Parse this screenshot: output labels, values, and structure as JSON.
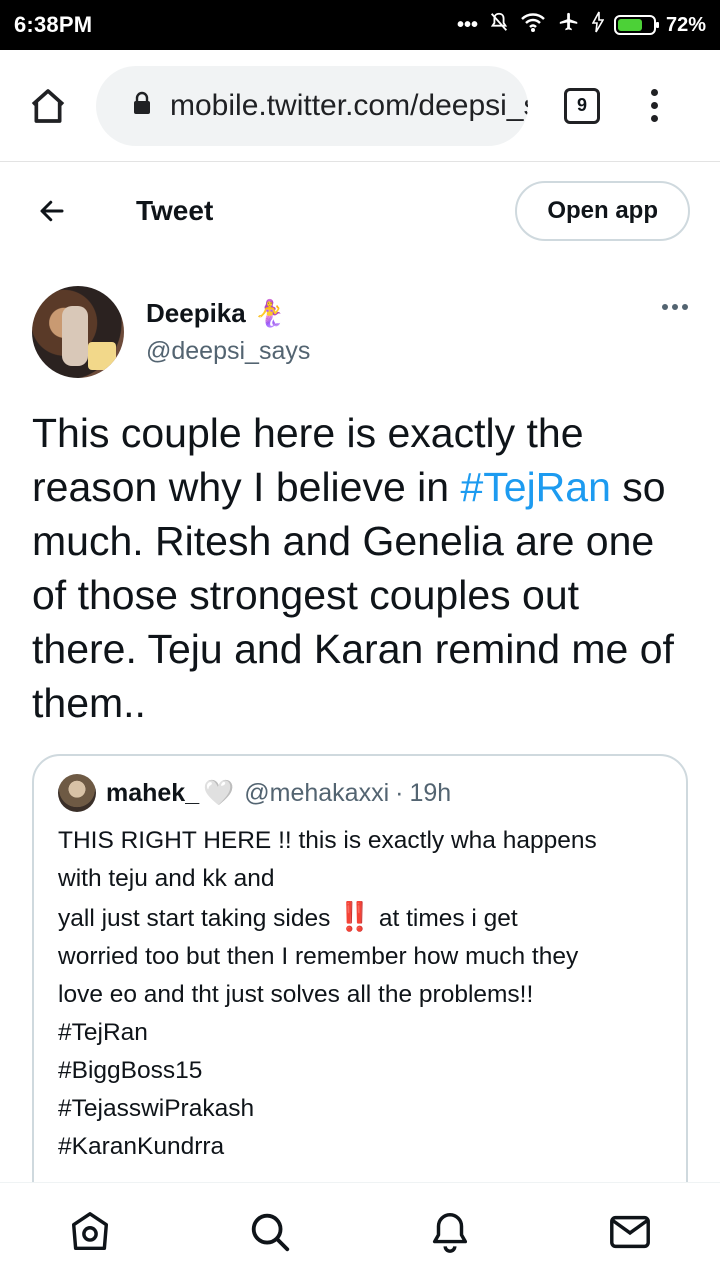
{
  "status_bar": {
    "time": "6:38PM",
    "battery": "72%",
    "battery_level": 0.72
  },
  "browser": {
    "url": "mobile.twitter.com/deepsi_says",
    "tab_count": "9"
  },
  "header": {
    "title": "Tweet",
    "open_app_label": "Open app"
  },
  "author": {
    "name": "Deepika",
    "emoji": "🧜‍♀️",
    "handle": "@deepsi_says"
  },
  "tweet": {
    "text_before": "This couple here is exactly the reason why I believe in ",
    "hashtag": "#TejRan",
    "text_after": " so much. Ritesh and Genelia are one of those strongest couples out there. Teju and Karan remind me of them.."
  },
  "quote": {
    "name": "mahek_",
    "heart": "🤍",
    "handle": "@mehakaxxi",
    "separator": "·",
    "time": "19h",
    "lines": [
      "THIS RIGHT HERE !! this is exactly wha happens",
      "with teju and kk and",
      "yall just start taking sides",
      "at times i get",
      "worried too but then I remember how much they",
      "love eo and tht just solves all the problems!!",
      "#TejRan",
      "#BiggBoss15",
      "#TejasswiPrakash",
      "#KaranKundrra"
    ],
    "bang_emoji": "‼️"
  },
  "colors": {
    "hashtag": "#1d9bf0",
    "secondary_text": "#536471",
    "border": "#cfd9de"
  },
  "nav_icons": [
    "home-icon",
    "search-icon",
    "notifications-bell-icon",
    "messages-envelope-icon"
  ]
}
